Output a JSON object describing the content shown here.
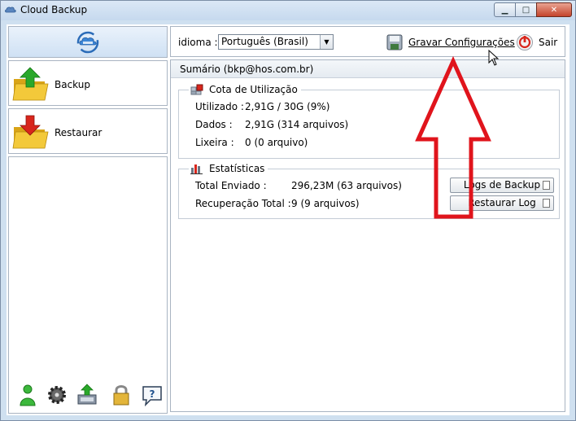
{
  "window": {
    "title": "Cloud Backup",
    "minimize": "▁",
    "maximize": "□",
    "close": "✕"
  },
  "sidebar": {
    "items": [
      {
        "label": "Backup",
        "icon": "folder-upload-icon"
      },
      {
        "label": "Restaurar",
        "icon": "folder-download-icon"
      }
    ],
    "tools": [
      "user-icon",
      "gear-icon",
      "upload-computer-icon",
      "lock-icon",
      "help-icon"
    ],
    "help_glyph": "?"
  },
  "toolbar": {
    "language_label": "idioma :",
    "language_value": "Português (Brasil)",
    "save_label": "Gravar Configurações",
    "exit_label": "Sair"
  },
  "summary": {
    "header": "Sumário (bkp@hos.com.br)",
    "usage": {
      "title": "Cota de Utilização",
      "rows": [
        {
          "label": "Utilizado :",
          "value": "2,91G / 30G (9%)"
        },
        {
          "label": "Dados :",
          "value": "2,91G  (314 arquivos)"
        },
        {
          "label": "Lixeira :",
          "value": "0  (0 arquivo)"
        }
      ]
    },
    "stats": {
      "title": "Estatísticas",
      "rows": [
        {
          "label": "Total Enviado :",
          "value": "296,23M  (63 arquivos)"
        },
        {
          "label": "Recuperação Total :",
          "value": "9  (9 arquivos)"
        }
      ],
      "buttons": {
        "backup_logs": "Logs de Backup",
        "restore_log": "Restaurar Log"
      }
    }
  },
  "colors": {
    "annotation_arrow": "#e0141c",
    "backup_arrow": "#2aa82a",
    "restore_arrow": "#d8261c",
    "folder": "#f2c62a"
  }
}
